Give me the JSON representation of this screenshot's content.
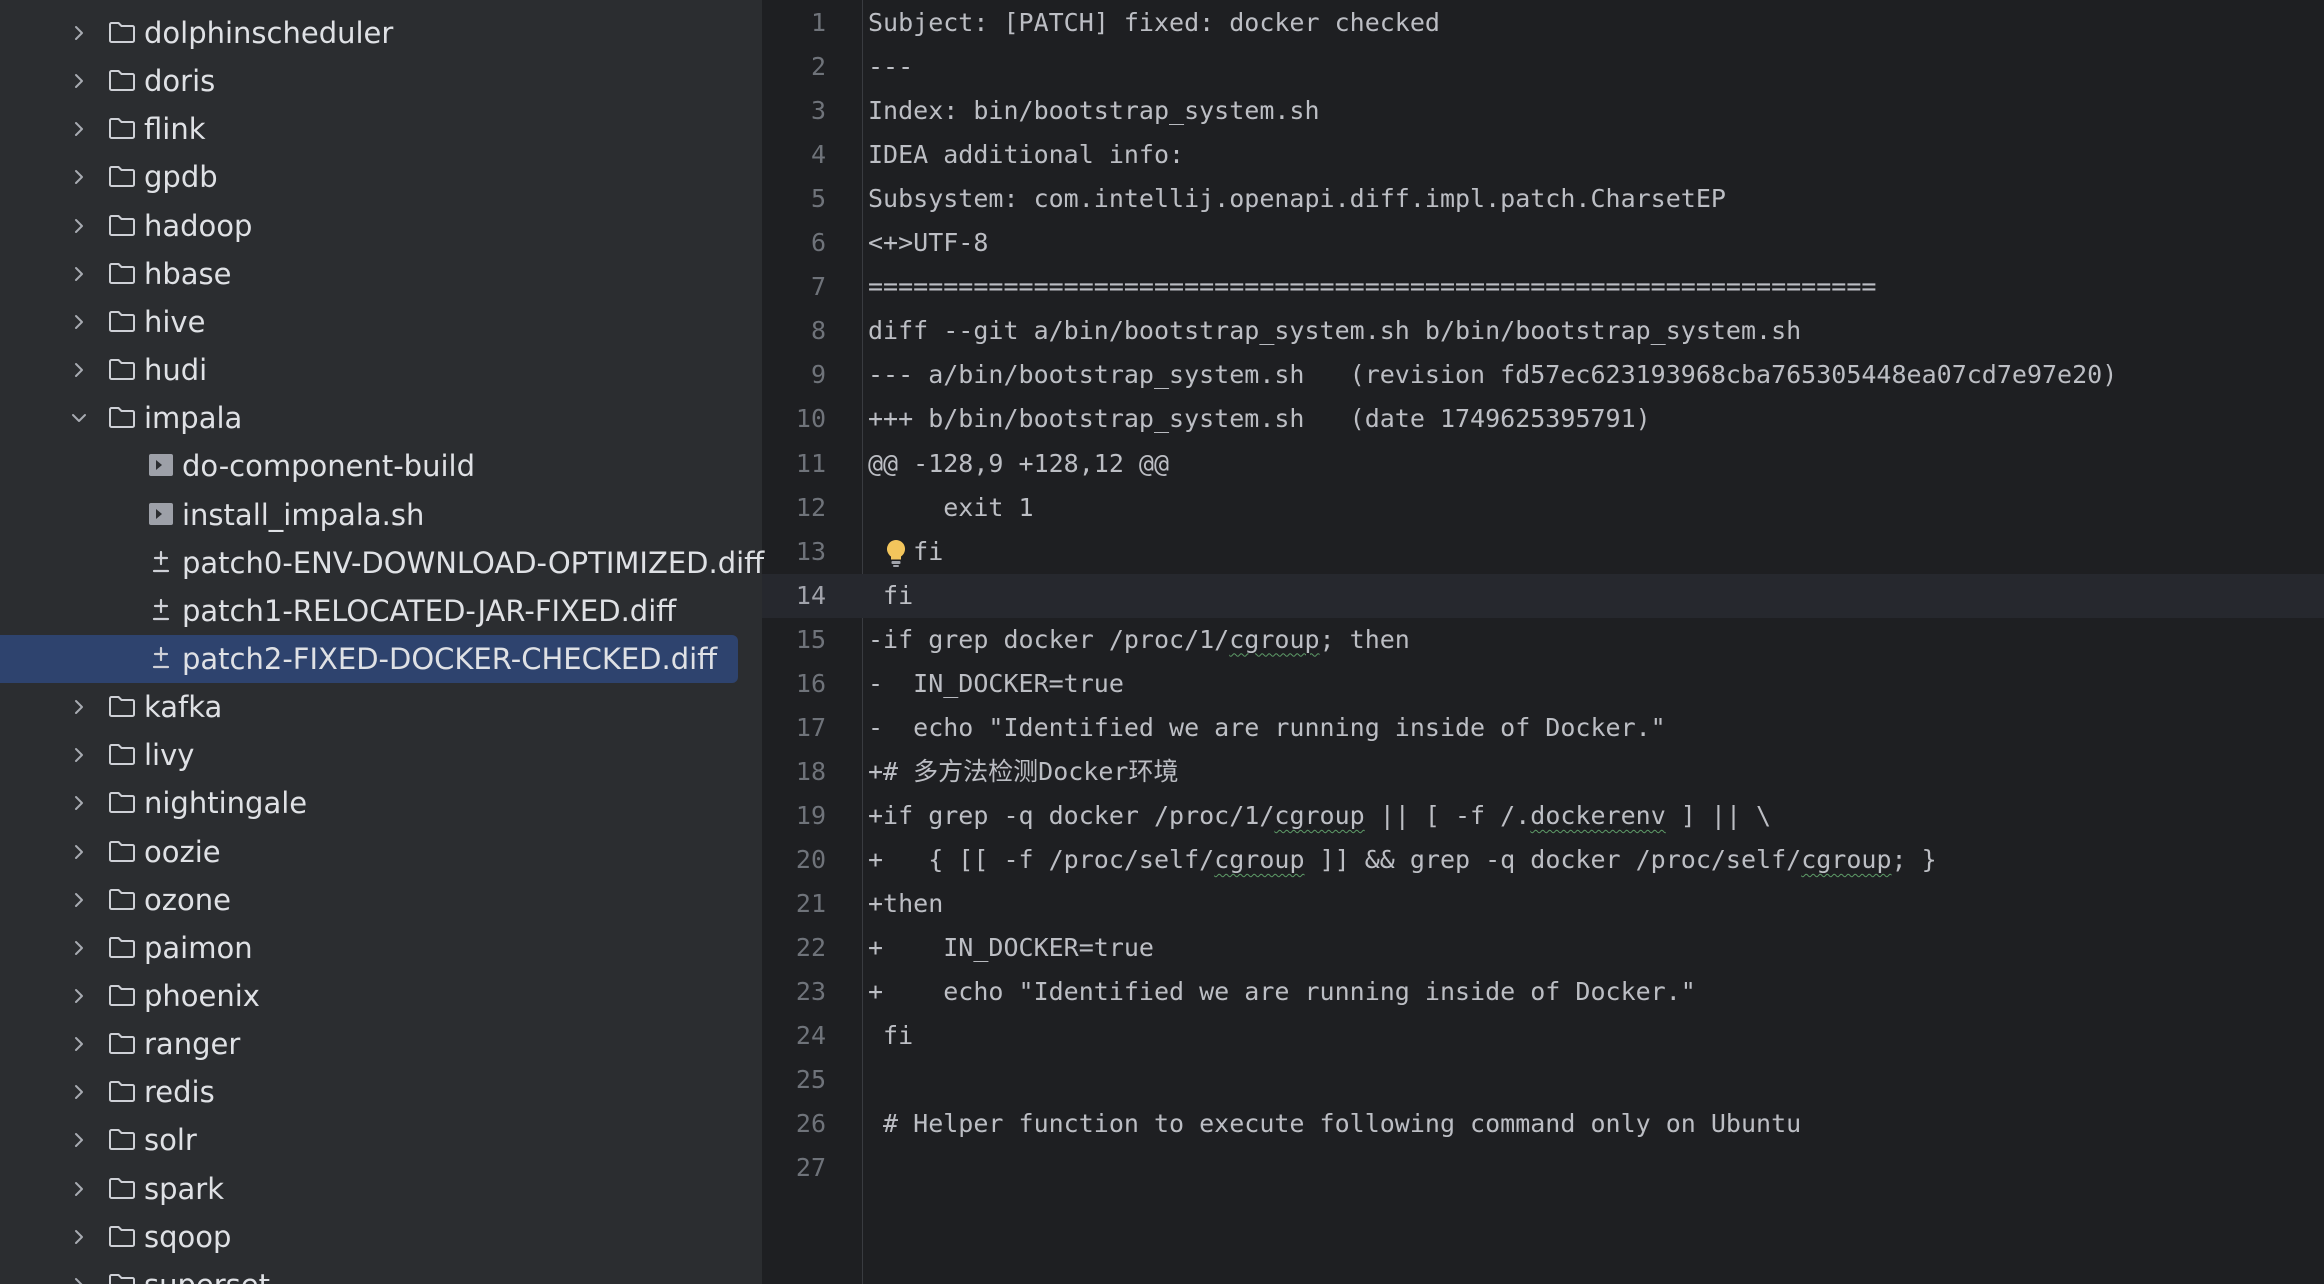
{
  "sidebar": {
    "items": [
      {
        "label": "dolphinscheduler",
        "type": "folder",
        "expanded": false
      },
      {
        "label": "doris",
        "type": "folder",
        "expanded": false
      },
      {
        "label": "flink",
        "type": "folder",
        "expanded": false
      },
      {
        "label": "gpdb",
        "type": "folder",
        "expanded": false
      },
      {
        "label": "hadoop",
        "type": "folder",
        "expanded": false
      },
      {
        "label": "hbase",
        "type": "folder",
        "expanded": false
      },
      {
        "label": "hive",
        "type": "folder",
        "expanded": false
      },
      {
        "label": "hudi",
        "type": "folder",
        "expanded": false
      },
      {
        "label": "impala",
        "type": "folder",
        "expanded": true
      },
      {
        "label": "do-component-build",
        "type": "script",
        "child": true
      },
      {
        "label": "install_impala.sh",
        "type": "script",
        "child": true
      },
      {
        "label": "patch0-ENV-DOWNLOAD-OPTIMIZED.diff",
        "type": "diff",
        "child": true
      },
      {
        "label": "patch1-RELOCATED-JAR-FIXED.diff",
        "type": "diff",
        "child": true
      },
      {
        "label": "patch2-FIXED-DOCKER-CHECKED.diff",
        "type": "diff",
        "child": true,
        "selected": true
      },
      {
        "label": "kafka",
        "type": "folder",
        "expanded": false
      },
      {
        "label": "livy",
        "type": "folder",
        "expanded": false
      },
      {
        "label": "nightingale",
        "type": "folder",
        "expanded": false
      },
      {
        "label": "oozie",
        "type": "folder",
        "expanded": false
      },
      {
        "label": "ozone",
        "type": "folder",
        "expanded": false
      },
      {
        "label": "paimon",
        "type": "folder",
        "expanded": false
      },
      {
        "label": "phoenix",
        "type": "folder",
        "expanded": false
      },
      {
        "label": "ranger",
        "type": "folder",
        "expanded": false
      },
      {
        "label": "redis",
        "type": "folder",
        "expanded": false
      },
      {
        "label": "solr",
        "type": "folder",
        "expanded": false
      },
      {
        "label": "spark",
        "type": "folder",
        "expanded": false
      },
      {
        "label": "sqoop",
        "type": "folder",
        "expanded": false
      },
      {
        "label": "superset",
        "type": "folder",
        "expanded": false
      }
    ]
  },
  "editor": {
    "current_line": 14,
    "lines": [
      {
        "number": "1",
        "text": "Subject: [PATCH] fixed: docker checked"
      },
      {
        "number": "2",
        "text": "---"
      },
      {
        "number": "3",
        "text": "Index: bin/bootstrap_system.sh"
      },
      {
        "number": "4",
        "text": "IDEA additional info:"
      },
      {
        "number": "5",
        "text": "Subsystem: com.intellij.openapi.diff.impl.patch.CharsetEP"
      },
      {
        "number": "6",
        "text": "<+>UTF-8"
      },
      {
        "number": "7",
        "text": "==================================================================="
      },
      {
        "number": "8",
        "text": "diff --git a/bin/bootstrap_system.sh b/bin/bootstrap_system.sh"
      },
      {
        "number": "9",
        "text": "--- a/bin/bootstrap_system.sh   (revision fd57ec623193968cba765305448ea07cd7e97e20)"
      },
      {
        "number": "10",
        "text": "+++ b/bin/bootstrap_system.sh   (date 1749625395791)"
      },
      {
        "number": "11",
        "text": "@@ -128,9 +128,12 @@"
      },
      {
        "number": "12",
        "text": "     exit 1"
      },
      {
        "number": "13",
        "text": "   fi",
        "bulb": true
      },
      {
        "number": "14",
        "text": " fi"
      },
      {
        "number": "15",
        "text": "-if grep docker /proc/1/cgroup; then"
      },
      {
        "number": "16",
        "text": "-  IN_DOCKER=true"
      },
      {
        "number": "17",
        "text": "-  echo \"Identified we are running inside of Docker.\""
      },
      {
        "number": "18",
        "text": "+# 多方法检测Docker环境"
      },
      {
        "number": "19",
        "text": "+if grep -q docker /proc/1/cgroup || [ -f /.dockerenv ] || \\"
      },
      {
        "number": "20",
        "text": "+   { [[ -f /proc/self/cgroup ]] && grep -q docker /proc/self/cgroup; }"
      },
      {
        "number": "21",
        "text": "+then"
      },
      {
        "number": "22",
        "text": "+    IN_DOCKER=true"
      },
      {
        "number": "23",
        "text": "+    echo \"Identified we are running inside of Docker.\""
      },
      {
        "number": "24",
        "text": " fi"
      },
      {
        "number": "25",
        "text": ""
      },
      {
        "number": "26",
        "text": " # Helper function to execute following command only on Ubuntu"
      },
      {
        "number": "27",
        "text": ""
      }
    ]
  },
  "colors": {
    "sidebar_bg": "#2b2d30",
    "editor_bg": "#1e1f22",
    "selection": "#2e436e",
    "current_line": "#26282e",
    "text": "#bcbec4",
    "line_number": "#6f737a",
    "bulb": "#f2c55c"
  },
  "icons": {
    "folder": "folder-icon",
    "script": "script-file-icon",
    "diff": "diff-file-icon",
    "collapsed": "chevron-right-icon",
    "expanded": "chevron-down-icon",
    "intention": "lightbulb-icon"
  }
}
